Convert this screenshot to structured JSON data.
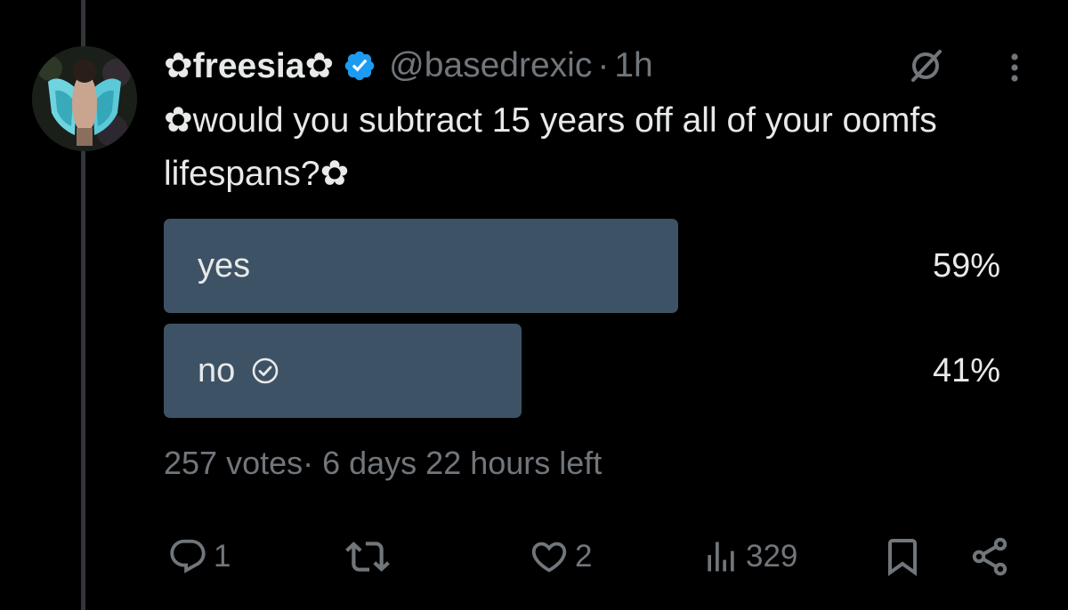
{
  "tweet": {
    "display_name": "✿freesia✿",
    "handle": "@basedrexic",
    "separator": "·",
    "time": "1h",
    "text": "✿would you subtract 15 years off all of your oomfs lifespans?✿",
    "colors": {
      "background": "#000000",
      "text": "#e7e9ea",
      "muted": "#71767b",
      "verified": "#1d9bf0",
      "poll_bar": "#3e5265"
    },
    "icons": {
      "verified": "verified-badge-icon",
      "grok": "grok-icon",
      "more": "more-vertical-icon"
    }
  },
  "poll": {
    "options": [
      {
        "label": "yes",
        "percent_text": "59%",
        "fraction": 0.59,
        "selected": false
      },
      {
        "label": "no",
        "percent_text": "41%",
        "fraction": 0.41,
        "selected": true
      }
    ],
    "meta": "257 votes· 6 days 22 hours left"
  },
  "actions": {
    "reply_count": "1",
    "retweet_count": "",
    "like_count": "2",
    "views_count": "329",
    "icons": [
      "reply-icon",
      "retweet-icon",
      "like-icon",
      "views-icon",
      "bookmark-icon",
      "share-icon"
    ]
  }
}
